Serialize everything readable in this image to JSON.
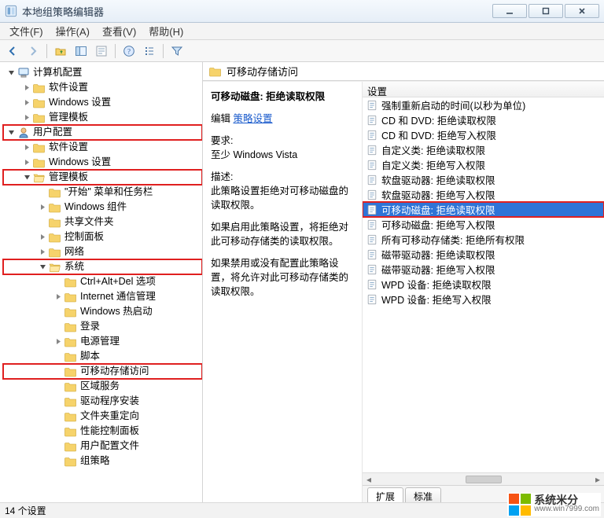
{
  "window": {
    "title": "本地组策略编辑器"
  },
  "menubar": {
    "file": "文件(F)",
    "action": "操作(A)",
    "view": "查看(V)",
    "help": "帮助(H)"
  },
  "right": {
    "header": "可移动存储访问",
    "detail": {
      "title": "可移动磁盘: 拒绝读取权限",
      "edit_label": "编辑",
      "edit_link": "策略设置",
      "req_label": "要求:",
      "req_value": "至少 Windows Vista",
      "desc_label": "描述:",
      "desc1": "此策略设置拒绝对可移动磁盘的读取权限。",
      "desc2": "如果启用此策略设置，将拒绝对此可移动存储类的读取权限。",
      "desc3": "如果禁用或没有配置此策略设置，将允许对此可移动存储类的读取权限。"
    },
    "list": {
      "header": "设置",
      "items": [
        "强制重新启动的时间(以秒为单位)",
        "CD 和 DVD: 拒绝读取权限",
        "CD 和 DVD: 拒绝写入权限",
        "自定义类: 拒绝读取权限",
        "自定义类: 拒绝写入权限",
        "软盘驱动器: 拒绝读取权限",
        "软盘驱动器: 拒绝写入权限",
        "可移动磁盘: 拒绝读取权限",
        "可移动磁盘: 拒绝写入权限",
        "所有可移动存储类: 拒绝所有权限",
        "磁带驱动器: 拒绝读取权限",
        "磁带驱动器: 拒绝写入权限",
        "WPD 设备: 拒绝读取权限",
        "WPD 设备: 拒绝写入权限"
      ],
      "selected_index": 7
    },
    "tabs": {
      "extended": "扩展",
      "standard": "标准"
    }
  },
  "tree": {
    "root": "计算机配置",
    "cc_soft": "软件设置",
    "cc_win": "Windows 设置",
    "cc_admt": "管理模板",
    "user": "用户配置",
    "uc_soft": "软件设置",
    "uc_win": "Windows 设置",
    "uc_admt": "管理模板",
    "start_tb": "\"开始\" 菜单和任务栏",
    "win_comp": "Windows 组件",
    "shared": "共享文件夹",
    "ctrlpanel": "控制面板",
    "network": "网络",
    "system": "系统",
    "cad": "Ctrl+Alt+Del 选项",
    "inet": "Internet 通信管理",
    "hotboot": "Windows 热启动",
    "login": "登录",
    "power": "电源管理",
    "script": "脚本",
    "removable": "可移动存储访问",
    "regional": "区域服务",
    "driver": "驱动程序安装",
    "folder_redir": "文件夹重定向",
    "perf_cp": "性能控制面板",
    "user_profiles": "用户配置文件",
    "gp": "组策略"
  },
  "status": {
    "count_text": "14 个设置"
  },
  "watermark": {
    "line1": "系统⽶分",
    "line2": "www.win7999.com"
  },
  "colors": {
    "selection": "#2e74d7",
    "redbox": "#e02020"
  }
}
